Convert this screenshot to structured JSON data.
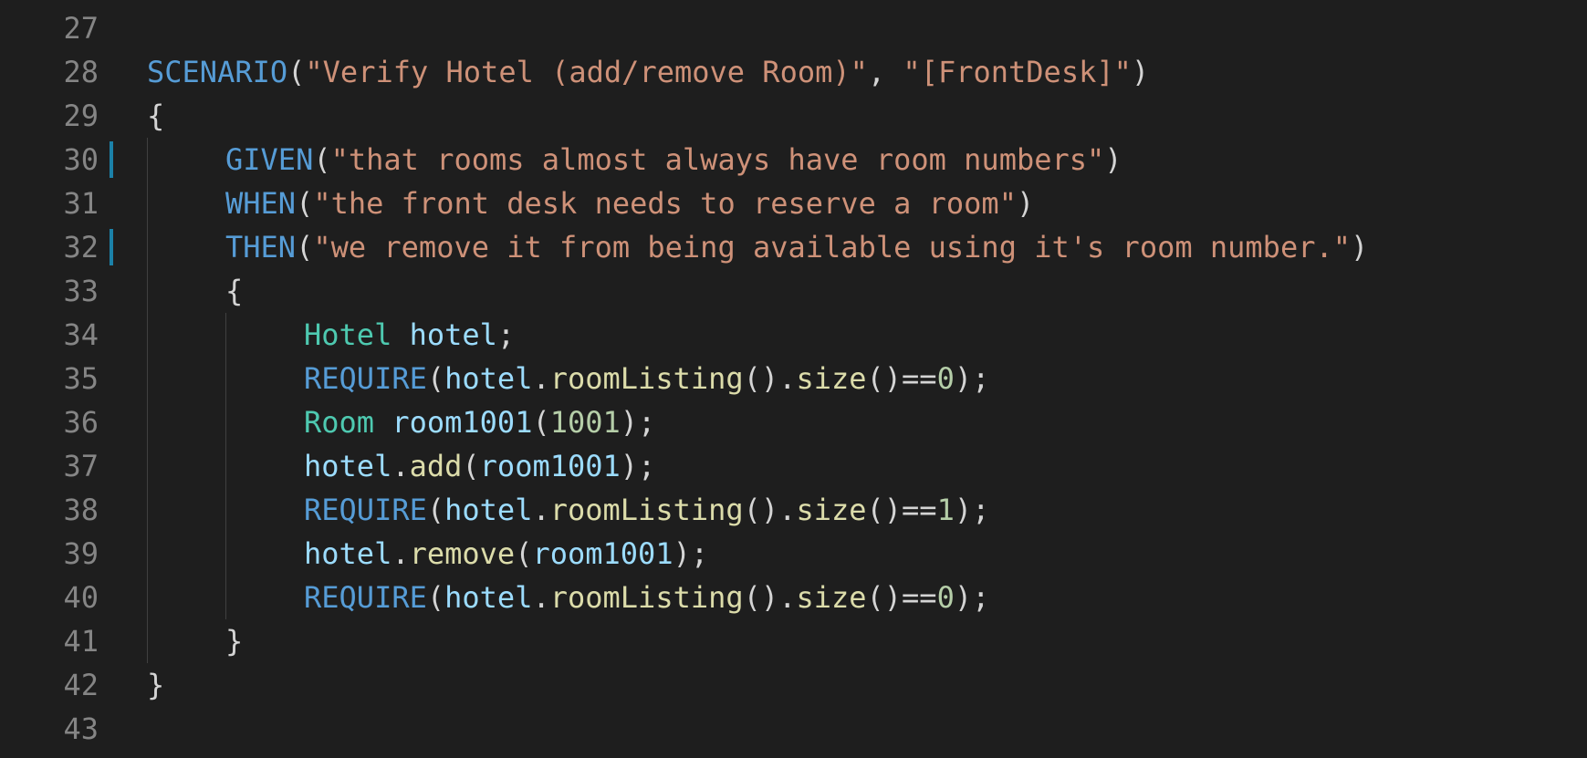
{
  "editor": {
    "colors": {
      "background": "#1e1e1e",
      "line_number": "#858585",
      "macro": "#569cd6",
      "string": "#ce9178",
      "type": "#4ec9b0",
      "function": "#dcdcaa",
      "variable": "#9cdcfe",
      "number": "#b5cea8",
      "punctuation": "#d4d4d4",
      "modified_marker": "#1b81a8"
    },
    "lines": [
      {
        "number": "27",
        "indent": 0,
        "modified": false,
        "tokens": []
      },
      {
        "number": "28",
        "indent": 0,
        "modified": false,
        "tokens": [
          {
            "t": "macro",
            "v": "SCENARIO"
          },
          {
            "t": "punct",
            "v": "("
          },
          {
            "t": "string",
            "v": "\"Verify Hotel (add/remove Room)\""
          },
          {
            "t": "punct",
            "v": ", "
          },
          {
            "t": "string",
            "v": "\"[FrontDesk]\""
          },
          {
            "t": "punct",
            "v": ")"
          }
        ]
      },
      {
        "number": "29",
        "indent": 0,
        "modified": false,
        "tokens": [
          {
            "t": "punct",
            "v": "{"
          }
        ]
      },
      {
        "number": "30",
        "indent": 1,
        "modified": true,
        "tokens": [
          {
            "t": "macro",
            "v": "GIVEN"
          },
          {
            "t": "punct",
            "v": "("
          },
          {
            "t": "string",
            "v": "\"that rooms almost always have room numbers\""
          },
          {
            "t": "punct",
            "v": ")"
          }
        ]
      },
      {
        "number": "31",
        "indent": 1,
        "modified": false,
        "tokens": [
          {
            "t": "macro",
            "v": "WHEN"
          },
          {
            "t": "punct",
            "v": "("
          },
          {
            "t": "string",
            "v": "\"the front desk needs to reserve a room\""
          },
          {
            "t": "punct",
            "v": ")"
          }
        ]
      },
      {
        "number": "32",
        "indent": 1,
        "modified": true,
        "tokens": [
          {
            "t": "macro",
            "v": "THEN"
          },
          {
            "t": "punct",
            "v": "("
          },
          {
            "t": "string",
            "v": "\"we remove it from being available using it's room number.\""
          },
          {
            "t": "punct",
            "v": ")"
          }
        ]
      },
      {
        "number": "33",
        "indent": 1,
        "modified": false,
        "tokens": [
          {
            "t": "punct",
            "v": "{"
          }
        ]
      },
      {
        "number": "34",
        "indent": 2,
        "modified": false,
        "tokens": [
          {
            "t": "type",
            "v": "Hotel"
          },
          {
            "t": "punct",
            "v": " "
          },
          {
            "t": "var",
            "v": "hotel"
          },
          {
            "t": "punct",
            "v": ";"
          }
        ]
      },
      {
        "number": "35",
        "indent": 2,
        "modified": false,
        "tokens": [
          {
            "t": "macro",
            "v": "REQUIRE"
          },
          {
            "t": "punct",
            "v": "("
          },
          {
            "t": "var",
            "v": "hotel"
          },
          {
            "t": "punct",
            "v": "."
          },
          {
            "t": "func",
            "v": "roomListing"
          },
          {
            "t": "punct",
            "v": "()."
          },
          {
            "t": "func",
            "v": "size"
          },
          {
            "t": "punct",
            "v": "()=="
          },
          {
            "t": "num",
            "v": "0"
          },
          {
            "t": "punct",
            "v": ");"
          }
        ]
      },
      {
        "number": "36",
        "indent": 2,
        "modified": false,
        "tokens": [
          {
            "t": "type",
            "v": "Room"
          },
          {
            "t": "punct",
            "v": " "
          },
          {
            "t": "var",
            "v": "room1001"
          },
          {
            "t": "punct",
            "v": "("
          },
          {
            "t": "num",
            "v": "1001"
          },
          {
            "t": "punct",
            "v": ");"
          }
        ]
      },
      {
        "number": "37",
        "indent": 2,
        "modified": false,
        "tokens": [
          {
            "t": "var",
            "v": "hotel"
          },
          {
            "t": "punct",
            "v": "."
          },
          {
            "t": "func",
            "v": "add"
          },
          {
            "t": "punct",
            "v": "("
          },
          {
            "t": "var",
            "v": "room1001"
          },
          {
            "t": "punct",
            "v": ");"
          }
        ]
      },
      {
        "number": "38",
        "indent": 2,
        "modified": false,
        "tokens": [
          {
            "t": "macro",
            "v": "REQUIRE"
          },
          {
            "t": "punct",
            "v": "("
          },
          {
            "t": "var",
            "v": "hotel"
          },
          {
            "t": "punct",
            "v": "."
          },
          {
            "t": "func",
            "v": "roomListing"
          },
          {
            "t": "punct",
            "v": "()."
          },
          {
            "t": "func",
            "v": "size"
          },
          {
            "t": "punct",
            "v": "()=="
          },
          {
            "t": "num",
            "v": "1"
          },
          {
            "t": "punct",
            "v": ");"
          }
        ]
      },
      {
        "number": "39",
        "indent": 2,
        "modified": false,
        "tokens": [
          {
            "t": "var",
            "v": "hotel"
          },
          {
            "t": "punct",
            "v": "."
          },
          {
            "t": "func",
            "v": "remove"
          },
          {
            "t": "punct",
            "v": "("
          },
          {
            "t": "var",
            "v": "room1001"
          },
          {
            "t": "punct",
            "v": ");"
          }
        ]
      },
      {
        "number": "40",
        "indent": 2,
        "modified": false,
        "tokens": [
          {
            "t": "macro",
            "v": "REQUIRE"
          },
          {
            "t": "punct",
            "v": "("
          },
          {
            "t": "var",
            "v": "hotel"
          },
          {
            "t": "punct",
            "v": "."
          },
          {
            "t": "func",
            "v": "roomListing"
          },
          {
            "t": "punct",
            "v": "()."
          },
          {
            "t": "func",
            "v": "size"
          },
          {
            "t": "punct",
            "v": "()=="
          },
          {
            "t": "num",
            "v": "0"
          },
          {
            "t": "punct",
            "v": ");"
          }
        ]
      },
      {
        "number": "41",
        "indent": 1,
        "modified": false,
        "tokens": [
          {
            "t": "punct",
            "v": "}"
          }
        ]
      },
      {
        "number": "42",
        "indent": 0,
        "modified": false,
        "tokens": [
          {
            "t": "punct",
            "v": "}"
          }
        ]
      },
      {
        "number": "43",
        "indent": 0,
        "modified": false,
        "tokens": []
      }
    ]
  }
}
